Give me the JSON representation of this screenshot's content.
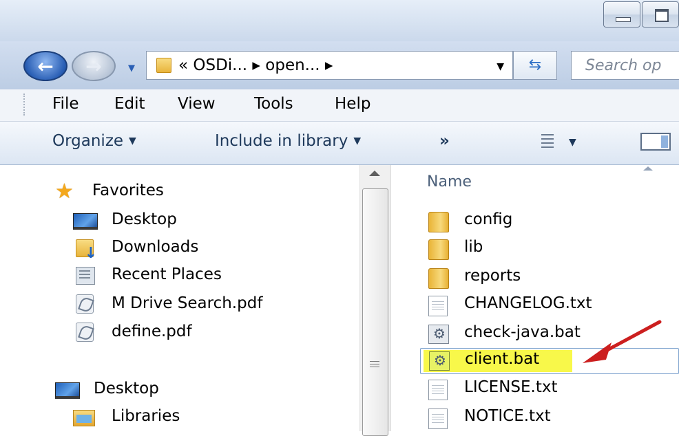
{
  "address": {
    "path": "« OSDi... ▸ open... ▸",
    "search_placeholder": "Search op"
  },
  "menu": [
    "File",
    "Edit",
    "View",
    "Tools",
    "Help"
  ],
  "commands": {
    "organize": "Organize",
    "include": "Include in library",
    "more": "»"
  },
  "nav": {
    "favorites": "Favorites",
    "items": [
      "Desktop",
      "Downloads",
      "Recent Places",
      "M Drive Search.pdf",
      "define.pdf"
    ],
    "desktop": "Desktop",
    "libraries": "Libraries"
  },
  "files": {
    "column_name": "Name",
    "items": [
      {
        "name": "config",
        "type": "folder"
      },
      {
        "name": "lib",
        "type": "folder"
      },
      {
        "name": "reports",
        "type": "folder"
      },
      {
        "name": "CHANGELOG.txt",
        "type": "text"
      },
      {
        "name": "check-java.bat",
        "type": "batch"
      },
      {
        "name": "client.bat",
        "type": "batch",
        "selected": true,
        "highlighted": true
      },
      {
        "name": "LICENSE.txt",
        "type": "text"
      },
      {
        "name": "NOTICE.txt",
        "type": "text"
      }
    ]
  },
  "colors": {
    "highlight": "#f8f84a",
    "annotation_arrow": "#cc1f1f"
  }
}
